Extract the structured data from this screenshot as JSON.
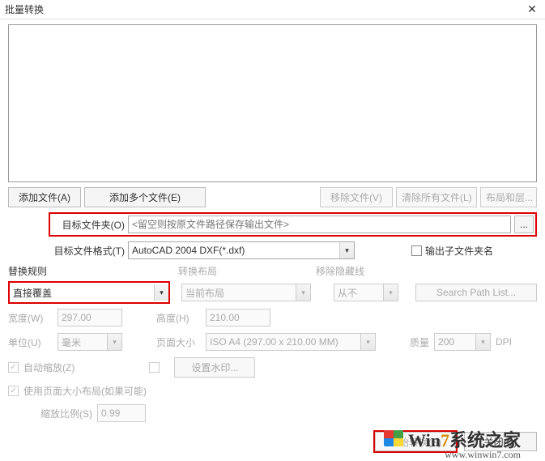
{
  "title": "批量转换",
  "buttons": {
    "add_file": "添加文件(A)",
    "add_multi": "添加多个文件(E)",
    "remove_file": "移除文件(V)",
    "clear_all": "清除所有文件(L)",
    "layout_layer": "布局和层...",
    "browse": "...",
    "set_watermark": "设置水印...",
    "search_path": "Search Path List...",
    "start": "开始转换(S)",
    "close": "关闭(C)"
  },
  "labels": {
    "target_folder": "目标文件夹(O)",
    "target_format": "目标文件格式(T)",
    "output_subfolder": "输出子文件夹名",
    "replace_rule": "替换规则",
    "convert_layout": "转换布局",
    "remove_hidden": "移除隐藏线",
    "width": "宽度(W)",
    "height": "高度(H)",
    "unit": "单位(U)",
    "page_size": "页面大小",
    "quality": "质量",
    "dpi": "DPI",
    "auto_zoom": "自动缩放(Z)",
    "use_page_layout": "使用页面大小布局(如果可能)",
    "scale_ratio": "缩放比例(S)"
  },
  "values": {
    "target_folder_placeholder": "<留空则按原文件路径保存输出文件>",
    "target_format": "AutoCAD 2004 DXF(*.dxf)",
    "replace_rule": "直接覆盖",
    "convert_layout": "当前布局",
    "remove_hidden": "从不",
    "width": "297.00",
    "height": "210.00",
    "unit": "毫米",
    "page_size": "ISO A4 (297.00 x 210.00 MM)",
    "quality": "200",
    "scale_ratio": "0.99"
  },
  "watermark": {
    "prefix": "Win",
    "digit": "7",
    "suffix": "系统之家",
    "sub": "www.winwin7.com"
  }
}
